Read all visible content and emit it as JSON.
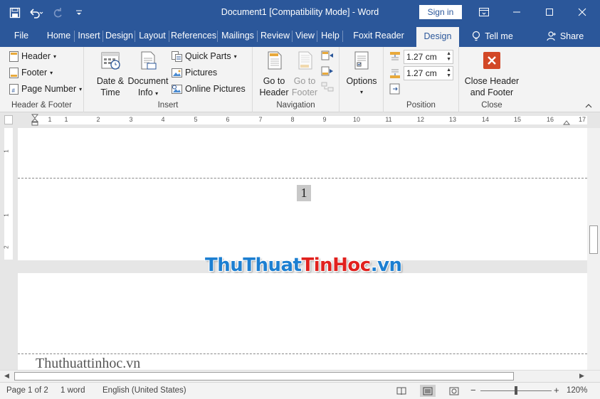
{
  "titlebar": {
    "title": "Document1 [Compatibility Mode]  -  Word",
    "signin": "Sign in",
    "colors": {
      "accent": "#2b579a"
    }
  },
  "tabs": [
    {
      "label": "File"
    },
    {
      "label": "Home"
    },
    {
      "label": "Insert"
    },
    {
      "label": "Design"
    },
    {
      "label": "Layout"
    },
    {
      "label": "References"
    },
    {
      "label": "Mailings"
    },
    {
      "label": "Review"
    },
    {
      "label": "View"
    },
    {
      "label": "Help"
    },
    {
      "label": "Foxit Reader PDF"
    },
    {
      "label": "Design"
    },
    {
      "label": "Tell me"
    },
    {
      "label": "Share"
    }
  ],
  "ribbon": {
    "header_footer": {
      "label": "Header & Footer",
      "header": "Header",
      "footer": "Footer",
      "page_number": "Page Number"
    },
    "insert": {
      "label": "Insert",
      "date_time_1": "Date &",
      "date_time_2": "Time",
      "doc_info_1": "Document",
      "doc_info_2": "Info",
      "quick_parts": "Quick Parts",
      "pictures": "Pictures",
      "online_pictures": "Online Pictures"
    },
    "navigation": {
      "label": "Navigation",
      "goto_header_1": "Go to",
      "goto_header_2": "Header",
      "goto_footer_1": "Go to",
      "goto_footer_2": "Footer"
    },
    "options": {
      "label": "Options"
    },
    "position": {
      "label": "Position",
      "header_from_top": "1.27 cm",
      "footer_from_bottom": "1.27 cm"
    },
    "close": {
      "label": "Close",
      "close_1": "Close Header",
      "close_2": "and Footer"
    }
  },
  "ruler": {
    "numbers": [
      "1",
      "1",
      "2",
      "3",
      "4",
      "5",
      "6",
      "7",
      "8",
      "9",
      "10",
      "11",
      "12",
      "13",
      "14",
      "15",
      "16",
      "17"
    ]
  },
  "vruler": {
    "numbers": [
      "1",
      "1",
      "2"
    ]
  },
  "document": {
    "page_number": "1",
    "watermark_part1": "ThuThuat",
    "watermark_part2": "TinHoc",
    "watermark_part3": ".vn",
    "footer_text": "Thuthuattinhoc.vn"
  },
  "status": {
    "page": "Page 1 of 2",
    "words": "1 word",
    "language": "English (United States)",
    "zoom": "120%"
  }
}
